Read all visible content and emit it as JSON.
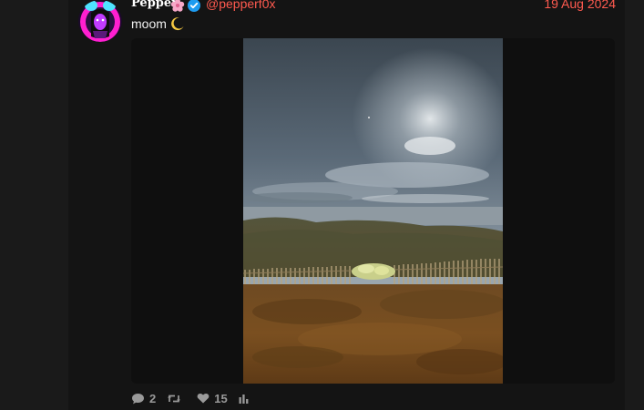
{
  "post": {
    "author": {
      "display_name": "Pepper",
      "handle": "@pepperf0x",
      "verified": true
    },
    "date": "19 Aug 2024",
    "text": "moom",
    "stats": {
      "replies": "2",
      "likes": "15"
    }
  },
  "icons": {
    "name_emoji": "cherry-blossom-icon",
    "verified": "verified-badge-icon",
    "text_emoji": "crescent-moon-icon",
    "reply": "reply-icon",
    "repost": "repost-icon",
    "like": "heart-icon",
    "stats": "analytics-icon"
  },
  "colors": {
    "accent": "#ff5a4f",
    "verified": "#1d9bf0",
    "background": "#141414"
  }
}
